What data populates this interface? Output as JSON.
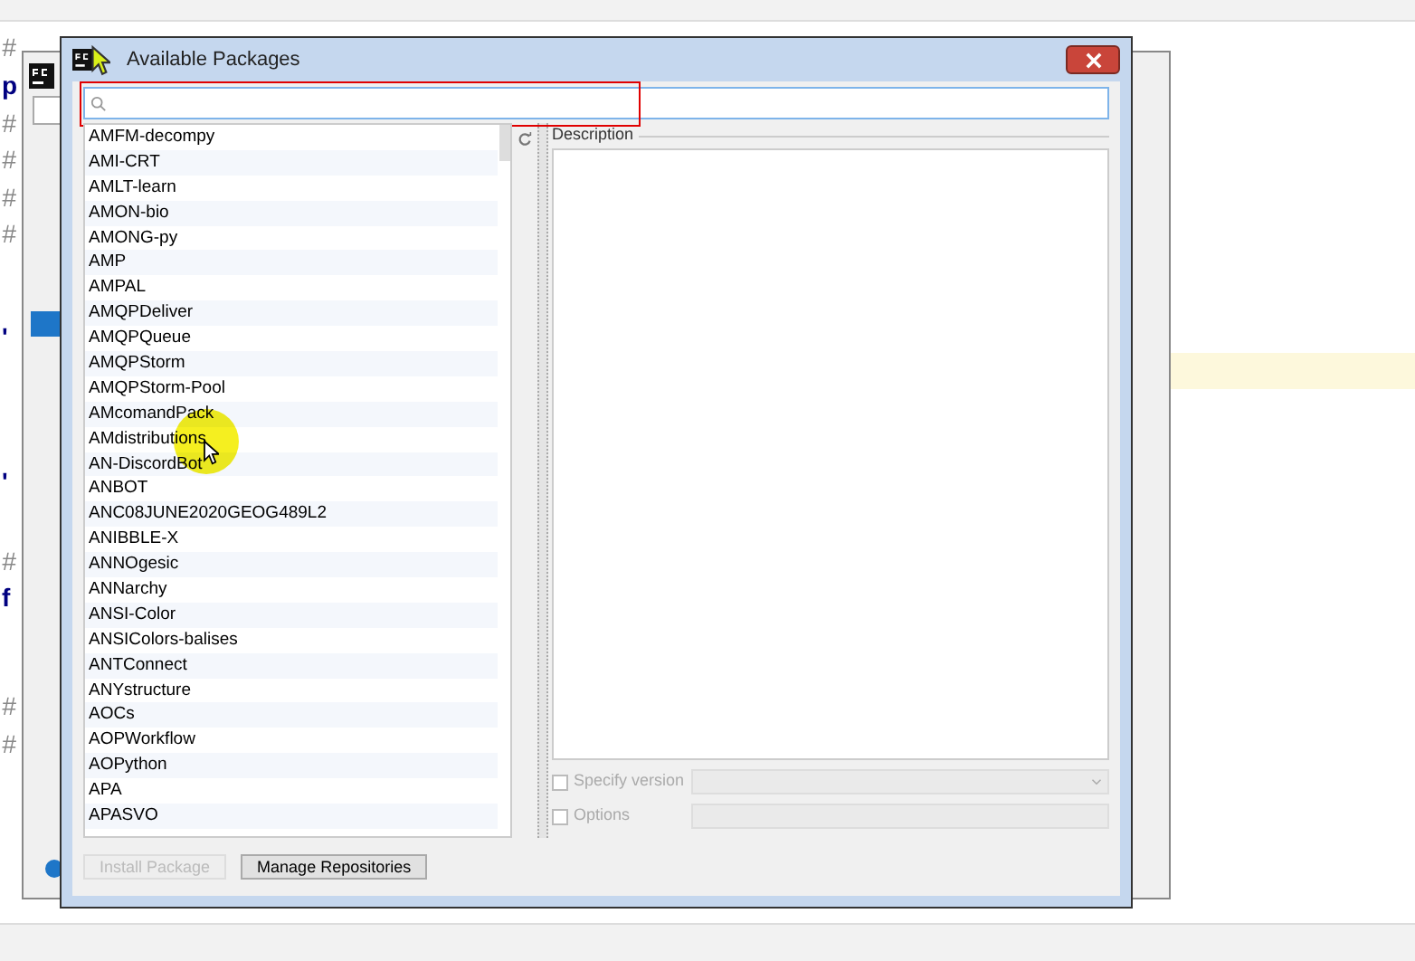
{
  "editor_gutter": [
    "#",
    "p",
    "#",
    "#",
    "#",
    "#",
    "'",
    "'",
    "#",
    "f",
    "#",
    "#"
  ],
  "dialog": {
    "title": "Available Packages",
    "packages": [
      "AMFM-decompy",
      "AMI-CRT",
      "AMLT-learn",
      "AMON-bio",
      "AMONG-py",
      "AMP",
      "AMPAL",
      "AMQPDeliver",
      "AMQPQueue",
      "AMQPStorm",
      "AMQPStorm-Pool",
      "AMcomandPack",
      "AMdistributions",
      "AN-DiscordBot",
      "ANBOT",
      "ANC08JUNE2020GEOG489L2",
      "ANIBBLE-X",
      "ANNOgesic",
      "ANNarchy",
      "ANSI-Color",
      "ANSIColors-balises",
      "ANTConnect",
      "ANYstructure",
      "AOCs",
      "AOPWorkflow",
      "AOPython",
      "APA",
      "APASVO"
    ],
    "description_label": "Description",
    "options": [
      {
        "label": "Specify version",
        "checked": false,
        "kind": "select"
      },
      {
        "label": "Options",
        "checked": false,
        "kind": "text"
      }
    ],
    "buttons": [
      {
        "label": "Install Package",
        "disabled": true
      },
      {
        "label": "Manage Repositories",
        "disabled": false
      }
    ]
  }
}
